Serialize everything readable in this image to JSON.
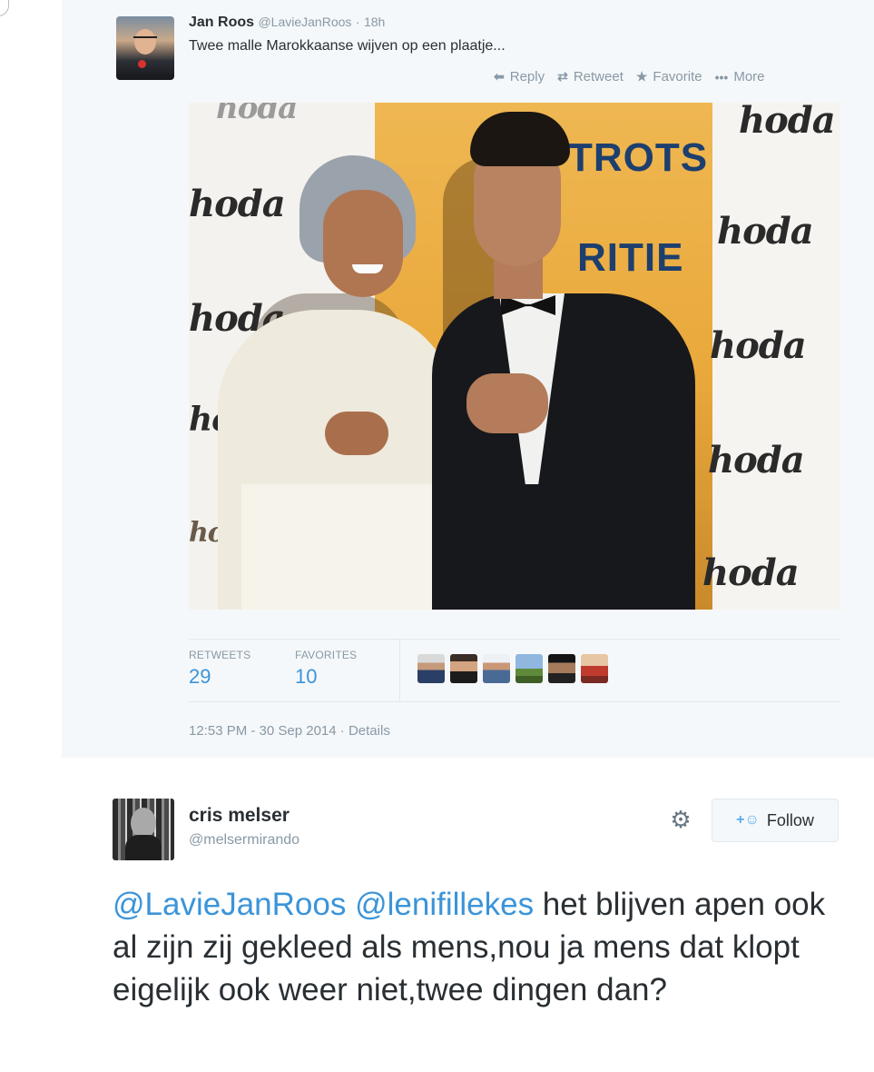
{
  "tweet1": {
    "author_name": "Jan Roos",
    "author_handle": "@LavieJanRoos",
    "separator": "·",
    "time": "18h",
    "text": "Twee malle Marokkaanse wijven op een plaatje...",
    "actions": {
      "reply": "Reply",
      "retweet": "Retweet",
      "favorite": "Favorite",
      "more": "More"
    },
    "photo_text": {
      "hoda": "hoda",
      "banner_line1": "TROTS",
      "banner_line2": "RITIE"
    },
    "stats": {
      "retweets_label": "RETWEETS",
      "retweets_value": "29",
      "favorites_label": "FAVORITES",
      "favorites_value": "10"
    },
    "date": "12:53 PM - 30 Sep 2014",
    "details_label": "Details"
  },
  "tweet2": {
    "author_name": "cris melser",
    "author_handle": "@melsermirando",
    "follow_label": "Follow",
    "mention1": "@LavieJanRoos",
    "mention2": "@lenifillekes",
    "body": " het blijven apen ook al zijn zij gekleed als mens,nou ja mens dat klopt eigelijk ook weer niet,twee dingen dan?"
  },
  "icons": {
    "reply": "reply-arrow-icon",
    "retweet": "retweet-icon",
    "favorite": "star-icon",
    "more": "ellipsis-icon",
    "settings": "gear-icon",
    "follow": "add-user-icon"
  },
  "colors": {
    "link": "#3b94d9",
    "muted": "#8899a6",
    "text": "#292f33",
    "card_bg": "#f5f8fa"
  }
}
